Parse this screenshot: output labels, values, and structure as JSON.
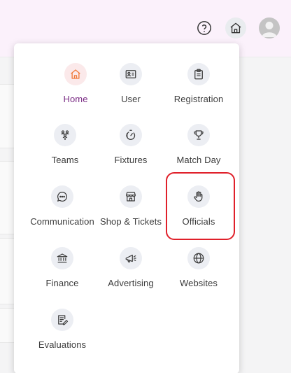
{
  "header": {
    "help_icon": "help-circle-icon",
    "home_icon": "home-icon",
    "avatar_icon": "user-avatar-icon"
  },
  "menu": {
    "items": [
      {
        "label": "Home",
        "icon": "home-icon",
        "active": true
      },
      {
        "label": "User",
        "icon": "id-card-icon"
      },
      {
        "label": "Registration",
        "icon": "clipboard-icon"
      },
      {
        "label": "Teams",
        "icon": "people-group-icon"
      },
      {
        "label": "Fixtures",
        "icon": "stopwatch-icon"
      },
      {
        "label": "Match Day",
        "icon": "trophy-icon"
      },
      {
        "label": "Communication",
        "icon": "chat-bubble-icon"
      },
      {
        "label": "Shop & Tickets",
        "icon": "storefront-icon"
      },
      {
        "label": "Officials",
        "icon": "raised-hand-icon",
        "highlighted": true
      },
      {
        "label": "Finance",
        "icon": "bank-icon"
      },
      {
        "label": "Advertising",
        "icon": "megaphone-icon"
      },
      {
        "label": "Websites",
        "icon": "globe-icon"
      },
      {
        "label": "Evaluations",
        "icon": "document-edit-icon"
      }
    ]
  },
  "colors": {
    "active_icon": "#f07c3c",
    "active_label": "#7a2b84",
    "highlight_border": "#e0202a",
    "icon_stroke": "#3a3a3a"
  }
}
